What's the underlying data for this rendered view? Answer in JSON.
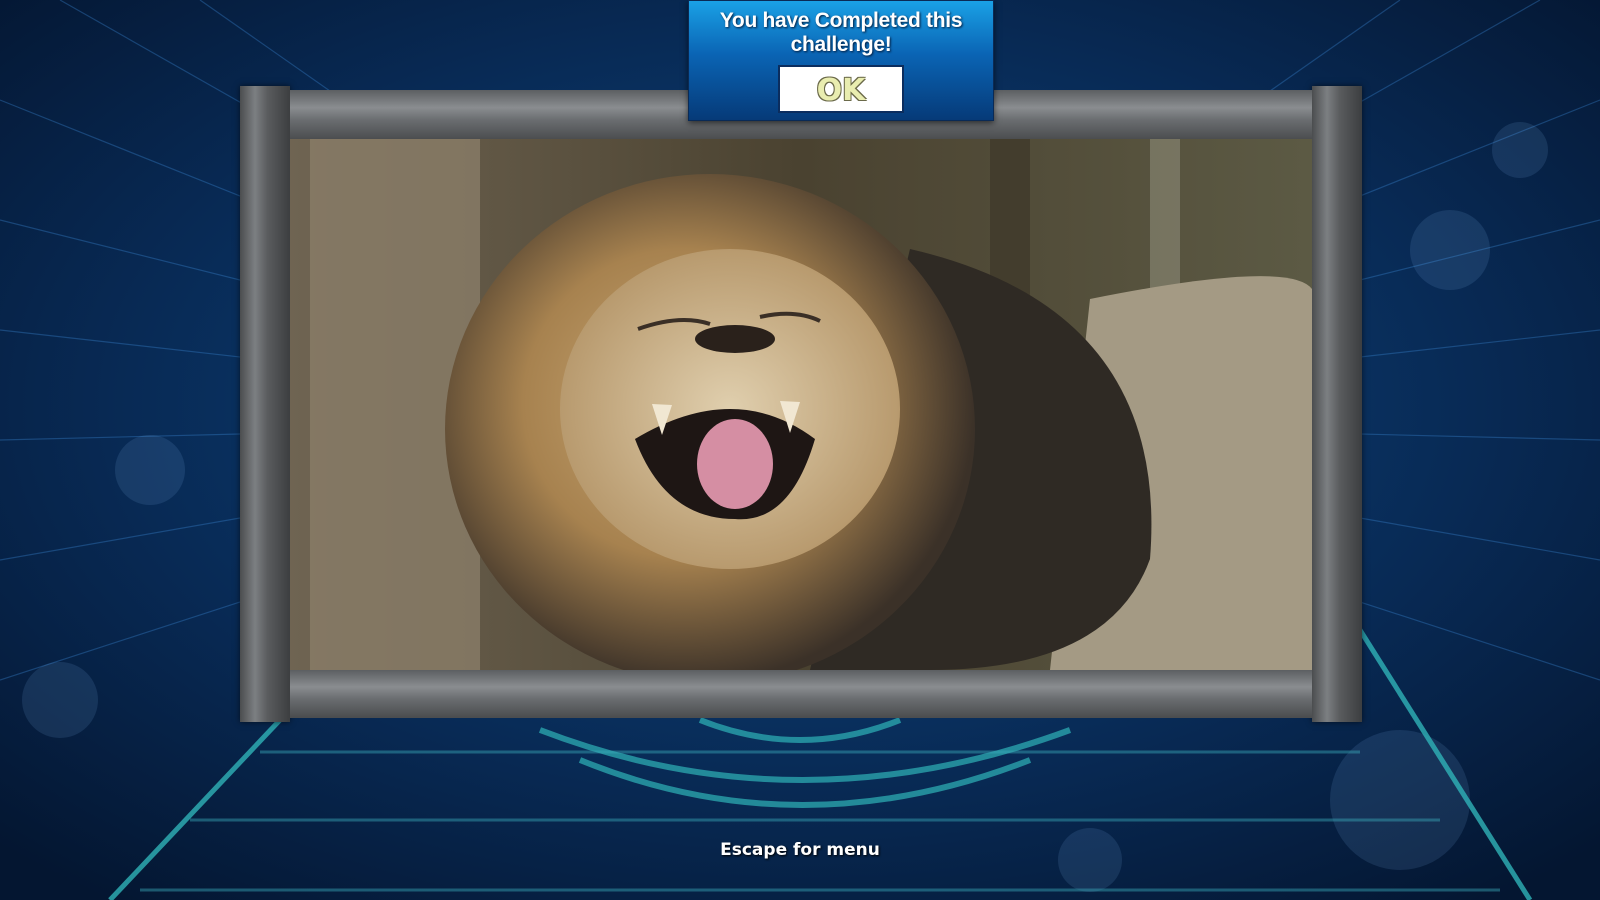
{
  "popup": {
    "message": "You have Completed this challenge!",
    "ok_label": "OK"
  },
  "footer": {
    "hint": "Escape for menu"
  },
  "colors": {
    "background": "#06203f",
    "popup_top": "#1aa1e6",
    "popup_bottom": "#063a78",
    "frame_metal": "#6a6d70"
  },
  "puzzle_image": {
    "subject": "roaring-lion"
  }
}
